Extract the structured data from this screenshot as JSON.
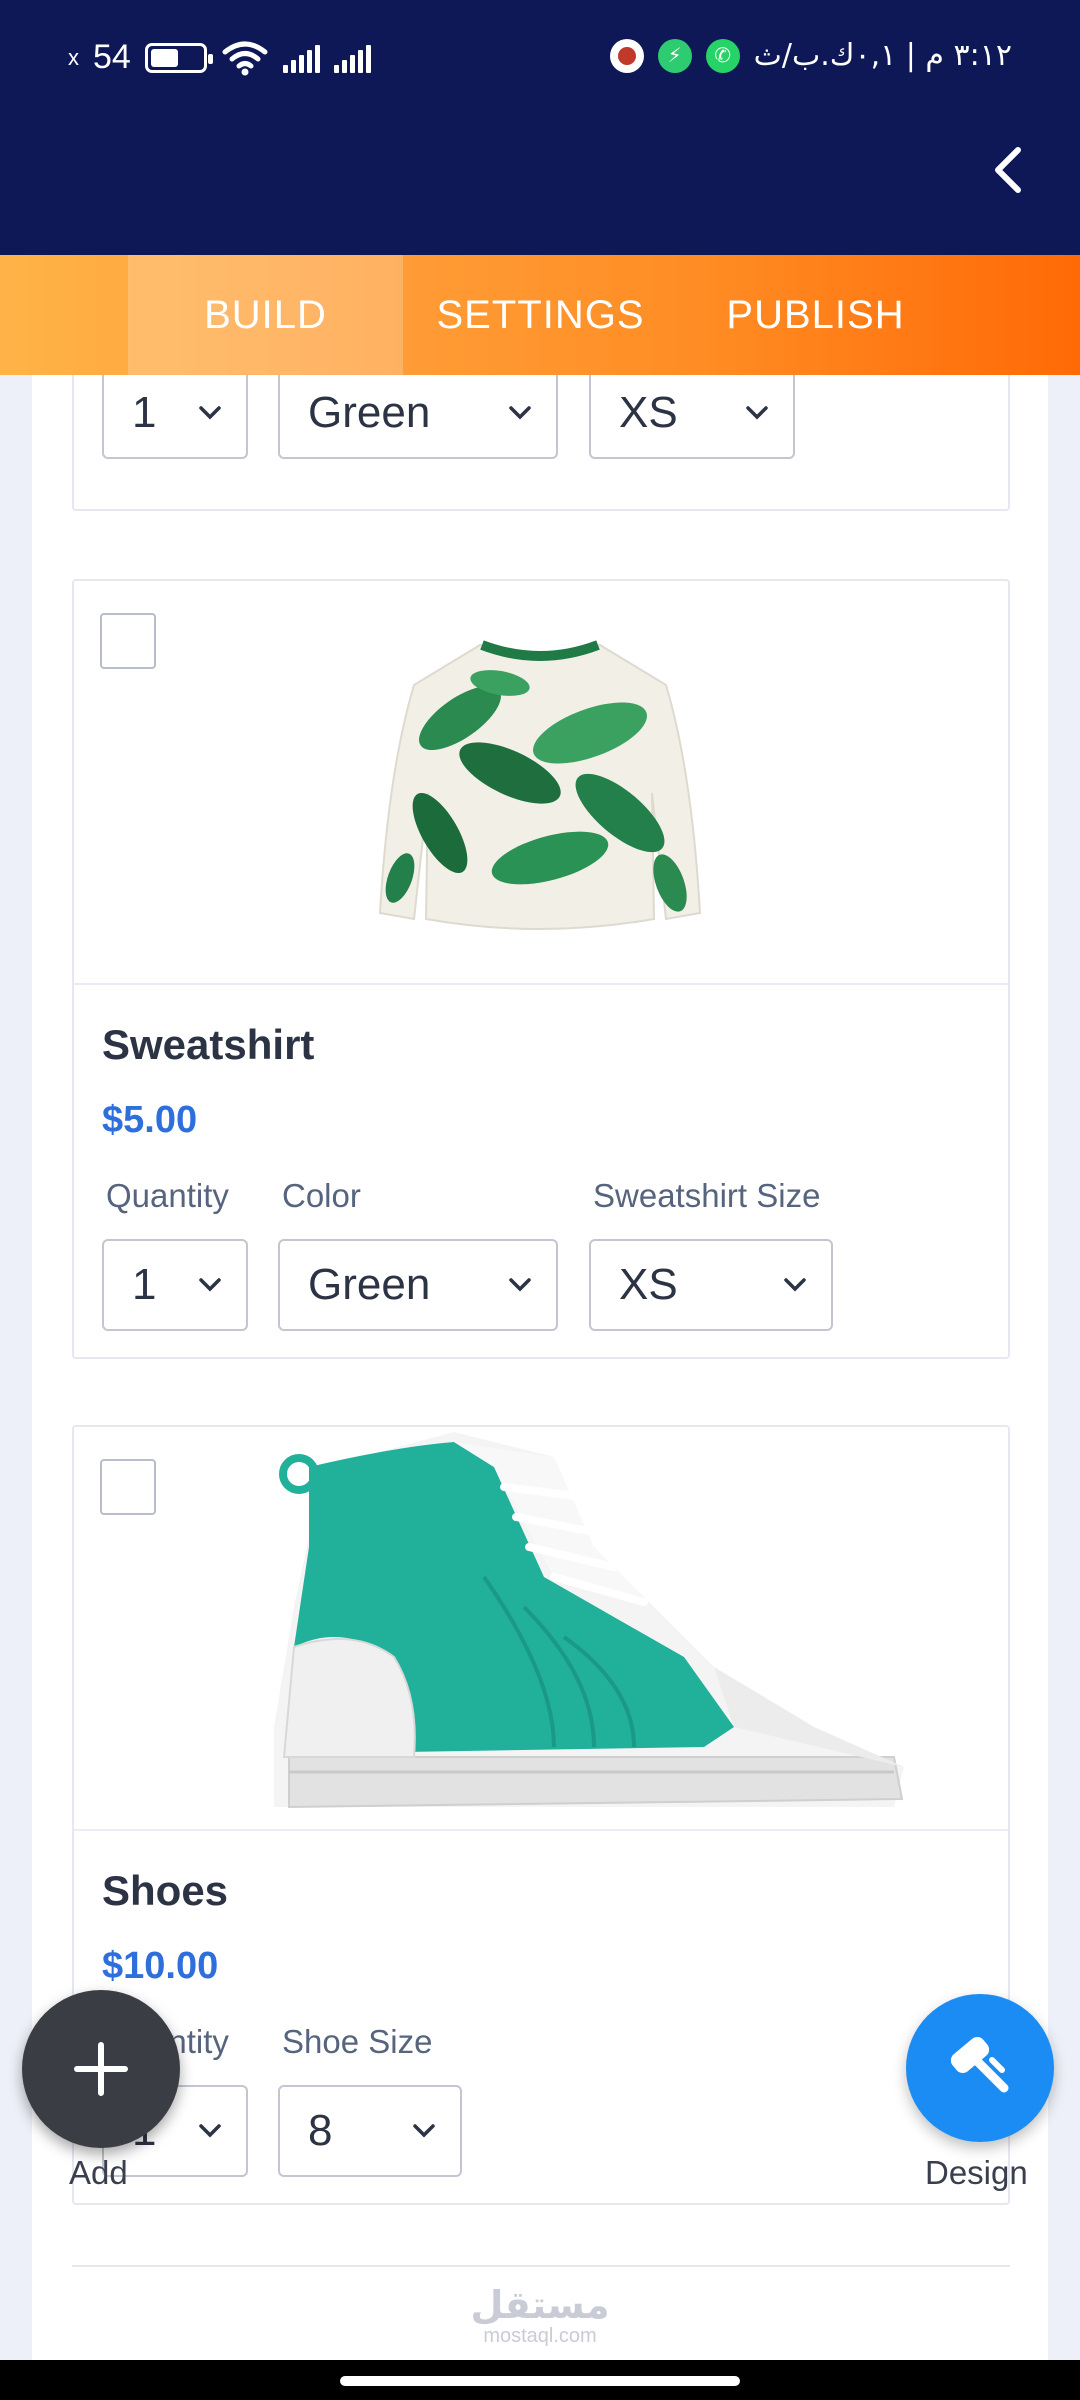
{
  "status_bar": {
    "time_rtl": "٣:١٢ م | ٠,١ك.ب/ث",
    "battery": "54",
    "battery_level": 0.54
  },
  "header": {
    "back_icon": "chevron-left-icon"
  },
  "tabs": [
    {
      "label": "BUILD",
      "active": true
    },
    {
      "label": "SETTINGS",
      "active": false
    },
    {
      "label": "PUBLISH",
      "active": false
    }
  ],
  "products": [
    {
      "name": "",
      "fields": [
        {
          "label": "",
          "value": "1"
        },
        {
          "label": "",
          "value": "Green"
        },
        {
          "label": "",
          "value": "XS"
        }
      ]
    },
    {
      "name": "Sweatshirt",
      "price": "$5.00",
      "fields": [
        {
          "label": "Quantity",
          "value": "1"
        },
        {
          "label": "Color",
          "value": "Green"
        },
        {
          "label": "Sweatshirt Size",
          "value": "XS"
        }
      ]
    },
    {
      "name": "Shoes",
      "price": "$10.00",
      "fields": [
        {
          "label": "Quantity",
          "value": "1"
        },
        {
          "label": "Shoe Size",
          "value": "8"
        }
      ]
    }
  ],
  "fab": {
    "add_label": "Add",
    "design_label": "Design"
  },
  "watermark": {
    "arabic": "مستقل",
    "latin": "mostaql.com"
  },
  "colors": {
    "header_bg": "#0e1856",
    "tab_gradient_start": "#ffb347",
    "tab_gradient_end": "#ff6a06",
    "price": "#2e6fdc",
    "design_fab": "#1a8cf3",
    "add_fab": "#3a3d44"
  }
}
